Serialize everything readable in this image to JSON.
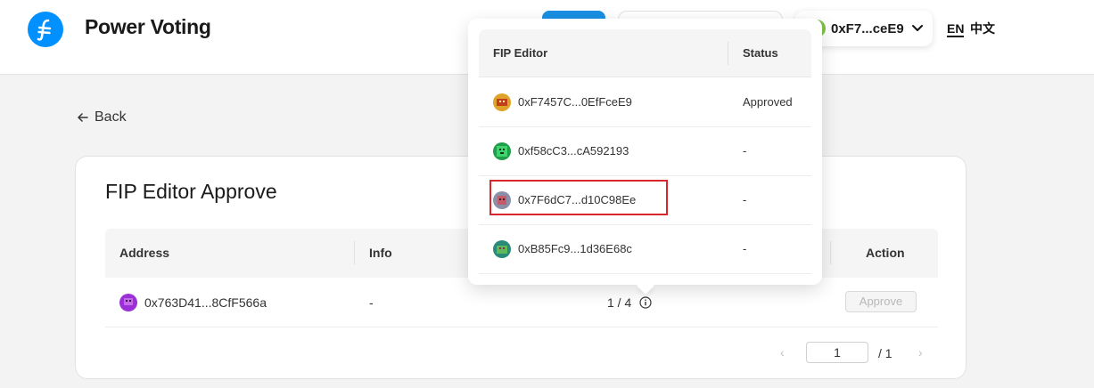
{
  "header": {
    "app_title": "Power Voting",
    "wallet_label": "0xF7...ceE9",
    "lang_en": "EN",
    "lang_zh": "中文"
  },
  "back_label": "Back",
  "card": {
    "title": "FIP Editor Approve",
    "columns": [
      "Address",
      "Info",
      "Action"
    ],
    "row": {
      "address": "0x763D41...8CfF566a",
      "info": "-",
      "approvals": "1 / 4",
      "action_label": "Approve"
    },
    "pagination": {
      "current_page": "1",
      "total": "/ 1"
    }
  },
  "popover": {
    "columns": [
      "FIP Editor",
      "Status"
    ],
    "rows": [
      {
        "address": "0xF7457C...0EfFceE9",
        "status": "Approved"
      },
      {
        "address": "0xf58cC3...cA592193",
        "status": "-"
      },
      {
        "address": "0x7F6dC7...d10C98Ee",
        "status": "-"
      },
      {
        "address": "0xB85Fc9...1d36E68c",
        "status": "-"
      }
    ]
  },
  "colors": {
    "accent": "#1a8fe3",
    "logo": "#0090ff",
    "highlight": "#d9262c",
    "wallet_dot": "#7fc04a"
  }
}
